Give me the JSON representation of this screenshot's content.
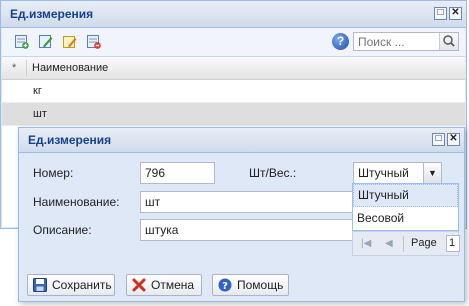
{
  "bg_window": {
    "title": "Ед.измерения",
    "search": {
      "placeholder": "Поиск ..."
    },
    "grid": {
      "header_marker": "*",
      "column": "Наименование",
      "rows": [
        "кг",
        "шт"
      ]
    }
  },
  "dialog": {
    "title": "Ед.измерения",
    "number_label": "Номер:",
    "number_value": "796",
    "type_label": "Шт/Вес.:",
    "type_value": "Штучный",
    "name_label": "Наименование:",
    "name_value": "шт",
    "desc_label": "Описание:",
    "desc_value": "штука",
    "save_label": "Сохранить",
    "cancel_label": "Отмена",
    "help_label": "Помощь"
  },
  "dropdown": {
    "options": [
      "Штучный",
      "Весовой"
    ]
  },
  "pager": {
    "page_label": "Page",
    "page_value": "1"
  },
  "colors": {
    "title_text": "#15428b",
    "panel_bg": "#dfe8f6",
    "border": "#99bbe8"
  }
}
